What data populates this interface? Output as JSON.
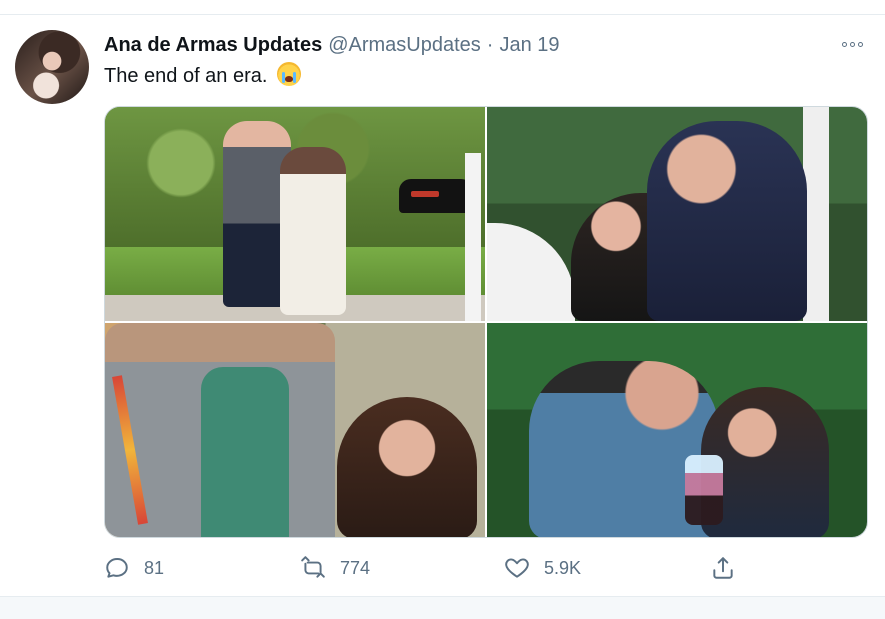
{
  "tweet": {
    "display_name": "Ana de Armas Updates",
    "handle": "@ArmasUpdates",
    "separator": "·",
    "date": "Jan 19",
    "text": "The end of an era.",
    "emoji": "loudly-crying-face",
    "more_icon": "more-icon",
    "media_count": 4
  },
  "metrics": {
    "replies": "81",
    "retweets": "774",
    "likes": "5.9K"
  },
  "icons": {
    "reply": "reply-icon",
    "retweet": "retweet-icon",
    "like": "heart-icon",
    "share": "share-icon"
  },
  "colors": {
    "text": "#0f1419",
    "secondary": "#5b7083",
    "border": "#cfd9de",
    "background": "#ffffff"
  }
}
